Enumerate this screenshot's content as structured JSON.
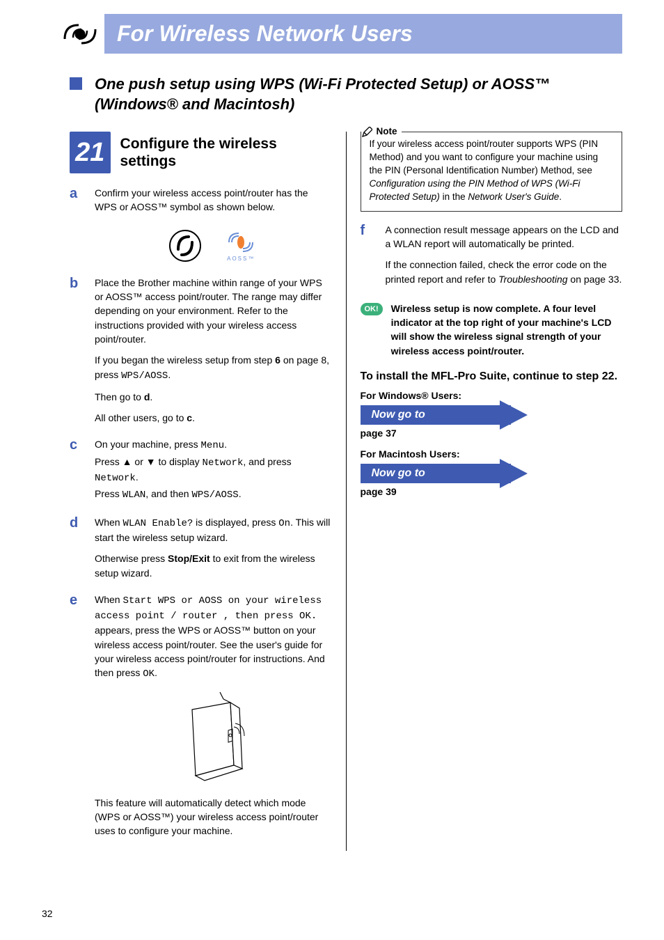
{
  "banner": {
    "title": "For Wireless Network Users"
  },
  "section": {
    "title_line1": "One push setup using WPS (Wi-Fi Protected Setup) or AOSS™",
    "title_line2": "(Windows® and Macintosh)"
  },
  "step": {
    "number": "21",
    "title": "Configure the wireless settings"
  },
  "substeps": {
    "a": {
      "letter": "a",
      "p1": "Confirm your wireless access point/router has the WPS or AOSS™ symbol as shown below."
    },
    "b": {
      "letter": "b",
      "p1": "Place the Brother machine within range of your WPS or AOSS™ access point/router. The range may differ depending on your environment. Refer to the instructions provided with your wireless access point/router.",
      "p2_pre": "If you began the wireless setup from step ",
      "p2_strong": "6",
      "p2_mid": " on page 8, press ",
      "p2_code": "WPS/AOSS",
      "p2_end": ".",
      "p3_pre": "Then go to ",
      "p3_strong": "d",
      "p3_end": ".",
      "p4_pre": "All other users, go to ",
      "p4_strong": "c",
      "p4_end": "."
    },
    "c": {
      "letter": "c",
      "l1_pre": "On your machine, press ",
      "l1_code": "Menu",
      "l1_end": ".",
      "l2_pre": "Press ▲ or ▼ to display ",
      "l2_code": "Network",
      "l2_mid": ", and press ",
      "l2_code2": "Network",
      "l2_end": ".",
      "l3_pre": "Press ",
      "l3_code": "WLAN",
      "l3_mid": ", and then ",
      "l3_code2": "WPS/AOSS",
      "l3_end": "."
    },
    "d": {
      "letter": "d",
      "p1_pre": "When ",
      "p1_code": "WLAN Enable?",
      "p1_mid": " is displayed, press ",
      "p1_code2": "On",
      "p1_end": ". This will start the wireless setup wizard.",
      "p2_pre": "Otherwise press ",
      "p2_strong": "Stop/Exit",
      "p2_end": " to exit from the wireless setup wizard."
    },
    "e": {
      "letter": "e",
      "p1_pre": "When ",
      "p1_code": "Start WPS or AOSS on your wireless access point / router , then press OK.",
      "p1_end": " appears, press the WPS or AOSS™ button on your wireless access point/router. See the user's guide for your wireless access point/router for instructions. And then press ",
      "p1_code2": "OK",
      "p1_dot": ".",
      "p2": "This feature will automatically detect which mode (WPS or AOSS™) your wireless access point/router uses to configure your machine."
    },
    "f": {
      "letter": "f",
      "p1": "A connection result message appears on the LCD and a WLAN report will automatically be printed.",
      "p2_pre": "If the connection failed, check the error code on the printed report and refer to ",
      "p2_em": "Troubleshooting",
      "p2_end": " on page 33."
    }
  },
  "note": {
    "label": "Note",
    "body_pre": "If your wireless access point/router supports WPS (PIN Method) and you want to configure your machine using the PIN (Personal Identification Number) Method, see ",
    "body_em": "Configuration using the PIN Method of WPS (Wi-Fi Protected Setup)",
    "body_mid": " in the ",
    "body_em2": "Network User's Guide",
    "body_end": "."
  },
  "ok": {
    "badge": "OK!",
    "text": "Wireless setup is now complete. A four level indicator at the top right of your machine's LCD will show the wireless signal strength of your wireless access point/router."
  },
  "install": {
    "title_pre": "To install the MFL-Pro Suite, continue to step ",
    "title_strong": "22",
    "title_end": ".",
    "windows_label": "For Windows® Users:",
    "goto": "Now go to",
    "windows_page": "page 37",
    "mac_label": "For Macintosh Users:",
    "mac_page": "page 39"
  },
  "footer": {
    "page": "32"
  },
  "symbols": {
    "aoss_label": "AOSS™"
  }
}
